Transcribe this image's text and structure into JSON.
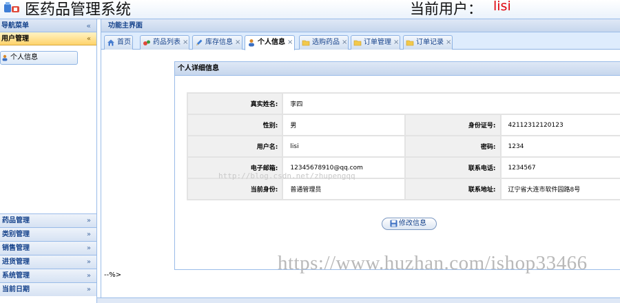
{
  "header": {
    "app_title": "医药品管理系统",
    "current_user_label": "当前用户：",
    "current_user_name": "lisi"
  },
  "sidebar": {
    "title": "导航菜单",
    "collapse_glyph": "«",
    "active_group": {
      "label": "用户管理",
      "toggle_glyph": "«"
    },
    "active_items": [
      {
        "label": "个人信息",
        "icon": "user-icon"
      }
    ],
    "groups": [
      {
        "label": "药品管理",
        "toggle_glyph": "»"
      },
      {
        "label": "类别管理",
        "toggle_glyph": "»"
      },
      {
        "label": "销售管理",
        "toggle_glyph": "»"
      },
      {
        "label": "进货管理",
        "toggle_glyph": "»"
      },
      {
        "label": "系统管理",
        "toggle_glyph": "»"
      },
      {
        "label": "当前日期",
        "toggle_glyph": "»"
      }
    ]
  },
  "main": {
    "title": "功能主界面",
    "tabs": [
      {
        "label": "首页",
        "icon": "home-icon",
        "closable": false
      },
      {
        "label": "药品列表",
        "icon": "pills-icon",
        "closable": true
      },
      {
        "label": "库存信息",
        "icon": "pencil-icon",
        "closable": true
      },
      {
        "label": "个人信息",
        "icon": "user-icon",
        "closable": true,
        "active": true
      },
      {
        "label": "选购药品",
        "icon": "folder-icon",
        "closable": true
      },
      {
        "label": "订单管理",
        "icon": "folder-icon",
        "closable": true
      },
      {
        "label": "订单记录",
        "icon": "folder-icon",
        "closable": true
      }
    ],
    "close_glyph": "×",
    "detail": {
      "title": "个人详细信息",
      "fields": {
        "real_name_label": "真实姓名:",
        "real_name": "李四",
        "gender_label": "性别:",
        "gender": "男",
        "id_label": "身份证号:",
        "id": "42112312120123",
        "username_label": "用户名:",
        "username": "lisi",
        "password_label": "密码:",
        "password": "1234",
        "email_label": "电子邮箱:",
        "email": "12345678910@qq.com",
        "phone_label": "联系电话:",
        "phone": "1234567",
        "role_label": "当前身份:",
        "role": "普通管理员",
        "address_label": "联系地址:",
        "address": "辽宁省大连市软件园路8号"
      },
      "edit_button": "修改信息"
    },
    "stray_text": "--%>",
    "watermark_small": "http://blog.csdn.net/zhupengqq",
    "watermark_large": "https://www.huzhan.com/ishop33466"
  },
  "colors": {
    "accent_border": "#99bbe8",
    "active_group": "#ffd36b",
    "username_red": "#e0000a"
  }
}
